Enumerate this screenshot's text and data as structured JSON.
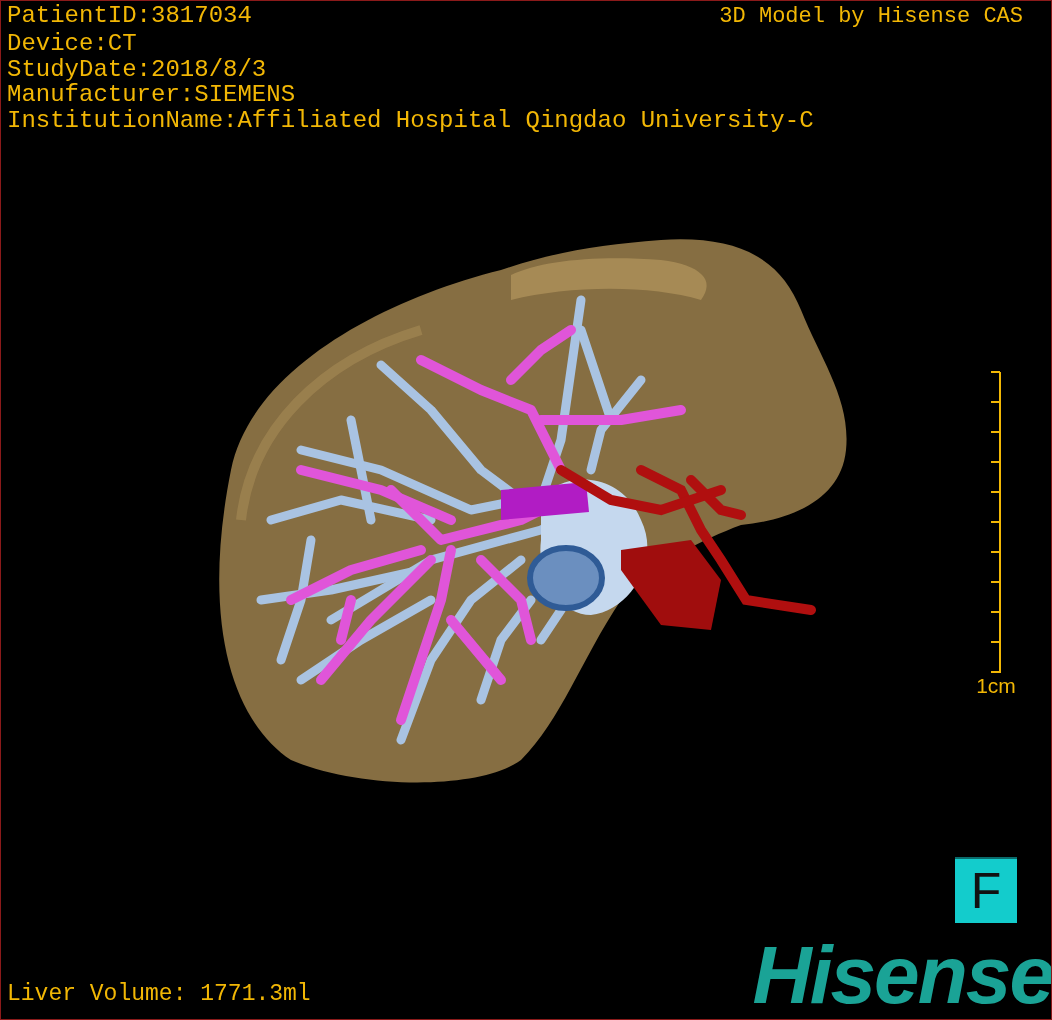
{
  "overlay": {
    "info_lines": [
      "PatientID:3817034",
      "Device:CT",
      "StudyDate:2018/8/3",
      "Manufacturer:SIEMENS",
      "InstitutionName:Affiliated Hospital Qingdao University-C"
    ],
    "title": "3D Model by Hisense CAS"
  },
  "scale_bar": {
    "label": "1cm"
  },
  "orientation": "F",
  "liver_volume": "Liver Volume: 1771.3ml",
  "logo": "Hisense"
}
